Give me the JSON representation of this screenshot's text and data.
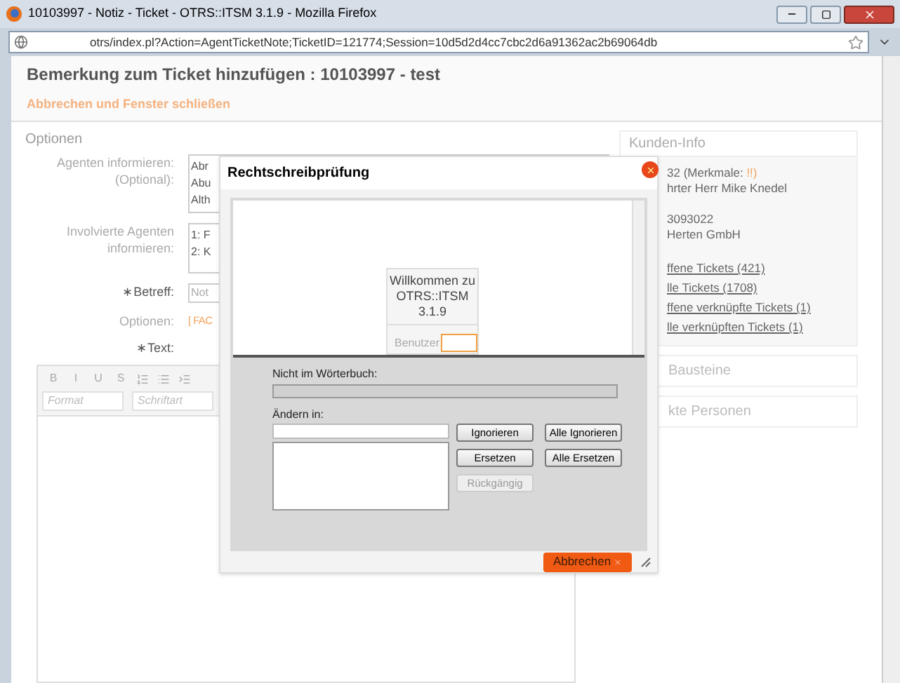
{
  "window": {
    "title": "10103997 - Notiz - Ticket - OTRS::ITSM 3.1.9 - Mozilla Firefox"
  },
  "address_bar": {
    "url": "otrs/index.pl?Action=AgentTicketNote;TicketID=121774;Session=10d5d2d4cc7cbc2d6a91362ac2b69064db"
  },
  "page": {
    "heading": "Bemerkung zum Ticket hinzufügen : 10103997 - test",
    "cancel_link": "Abbrechen und Fenster schließen"
  },
  "options": {
    "title": "Optionen",
    "fields": [
      {
        "kind": "list",
        "label_lines": [
          "Agenten informieren:",
          "(Optional):"
        ],
        "lines": [
          "Abr",
          "Abu",
          "Alth"
        ]
      },
      {
        "kind": "list",
        "label_lines": [
          "Involvierte Agenten",
          "informieren:"
        ],
        "lines": [
          "1: F",
          "2: K"
        ]
      },
      {
        "kind": "input",
        "label_lines": [
          "∗Betreff:"
        ],
        "value": "Not"
      },
      {
        "kind": "link",
        "label_lines": [
          "Optionen:"
        ],
        "value": "[ FAC"
      },
      {
        "kind": "editor",
        "label_lines": [
          "∗Text:"
        ]
      }
    ],
    "editor": {
      "buttons": [
        "B",
        "I",
        "U",
        "S"
      ],
      "dropdowns": [
        "Format",
        "Schriftart"
      ]
    }
  },
  "sidebar": {
    "title": "Kunden-Info",
    "lines": [
      {
        "kind": "text",
        "text": "32 (Merkmale: ",
        "extra": "!!)"
      },
      {
        "kind": "text",
        "text": "hrter Herr Mike Knedel"
      },
      {
        "kind": "gap"
      },
      {
        "kind": "text",
        "text": "3093022"
      },
      {
        "kind": "text",
        "text": "Herten GmbH"
      },
      {
        "kind": "gap"
      },
      {
        "kind": "link",
        "text": "ffene Tickets (421)"
      },
      {
        "kind": "link",
        "text": "lle Tickets (1708)"
      },
      {
        "kind": "link",
        "text": "ffene verknüpfte Tickets (1)"
      },
      {
        "kind": "link",
        "text": "lle verknüpften Tickets (1)"
      }
    ],
    "sections": [
      "Bausteine",
      "kte Personen"
    ]
  },
  "dialog": {
    "title": "Rechtschreibprüfung",
    "preview": {
      "welcome": [
        "Willkommen zu",
        "OTRS::ITSM 3.1.9"
      ],
      "user_label": "Benutzer"
    },
    "not_in_dictionary_label": "Nicht im Wörterbuch:",
    "change_to_label": "Ändern in:",
    "buttons": [
      {
        "label": "Ignorieren",
        "disabled": false
      },
      {
        "label": "Alle Ignorieren",
        "disabled": false
      },
      {
        "label": "Ersetzen",
        "disabled": false
      },
      {
        "label": "Alle Ersetzen",
        "disabled": false
      },
      {
        "label": "Rückgängig",
        "disabled": true
      }
    ],
    "cancel_button": "Abbrechen"
  }
}
